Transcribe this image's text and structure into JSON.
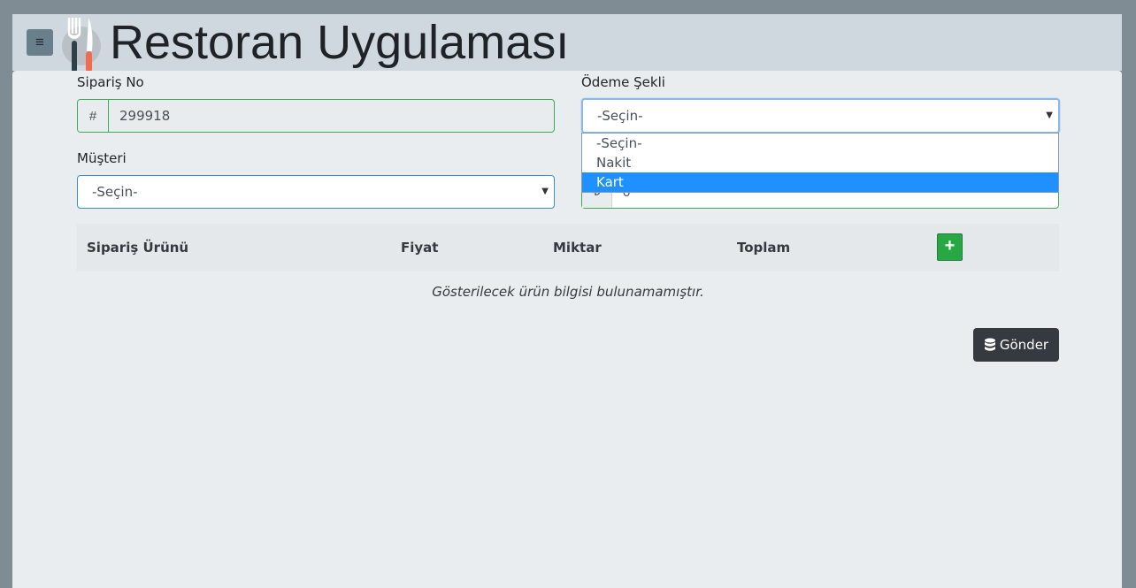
{
  "header": {
    "title": "Restoran Uygulaması",
    "menu_icon": "hamburger-menu-icon",
    "logo_icon": "fork-knife-icon"
  },
  "form": {
    "order_no_label": "Sipariş No",
    "order_no_prefix": "#",
    "order_no_value": "299918",
    "customer_label": "Müşteri",
    "customer_value": "-Seçin-",
    "payment_label": "Ödeme Şekli",
    "payment_value": "-Seçin-",
    "payment_options": [
      "-Seçin-",
      "Nakit",
      "Kart"
    ],
    "payment_highlighted_option": "Kart",
    "amount_prefix": "₺",
    "amount_value": "0"
  },
  "table": {
    "columns": [
      "Sipariş Ürünü",
      "Fiyat",
      "Miktar",
      "Toplam"
    ],
    "add_icon": "plus-icon",
    "empty_message": "Gösterilecek ürün bilgisi bulunamamıştır."
  },
  "submit": {
    "label": "Gönder",
    "icon": "database-icon"
  },
  "colors": {
    "background": "#7f8c94",
    "header_bg": "#cfd8de",
    "panel_bg": "#e9edf0",
    "valid_border": "#3daa55",
    "focus_border": "#3a8fd6",
    "highlight": "#1e90ff",
    "add_button": "#28a745",
    "submit_button": "#343a40"
  }
}
